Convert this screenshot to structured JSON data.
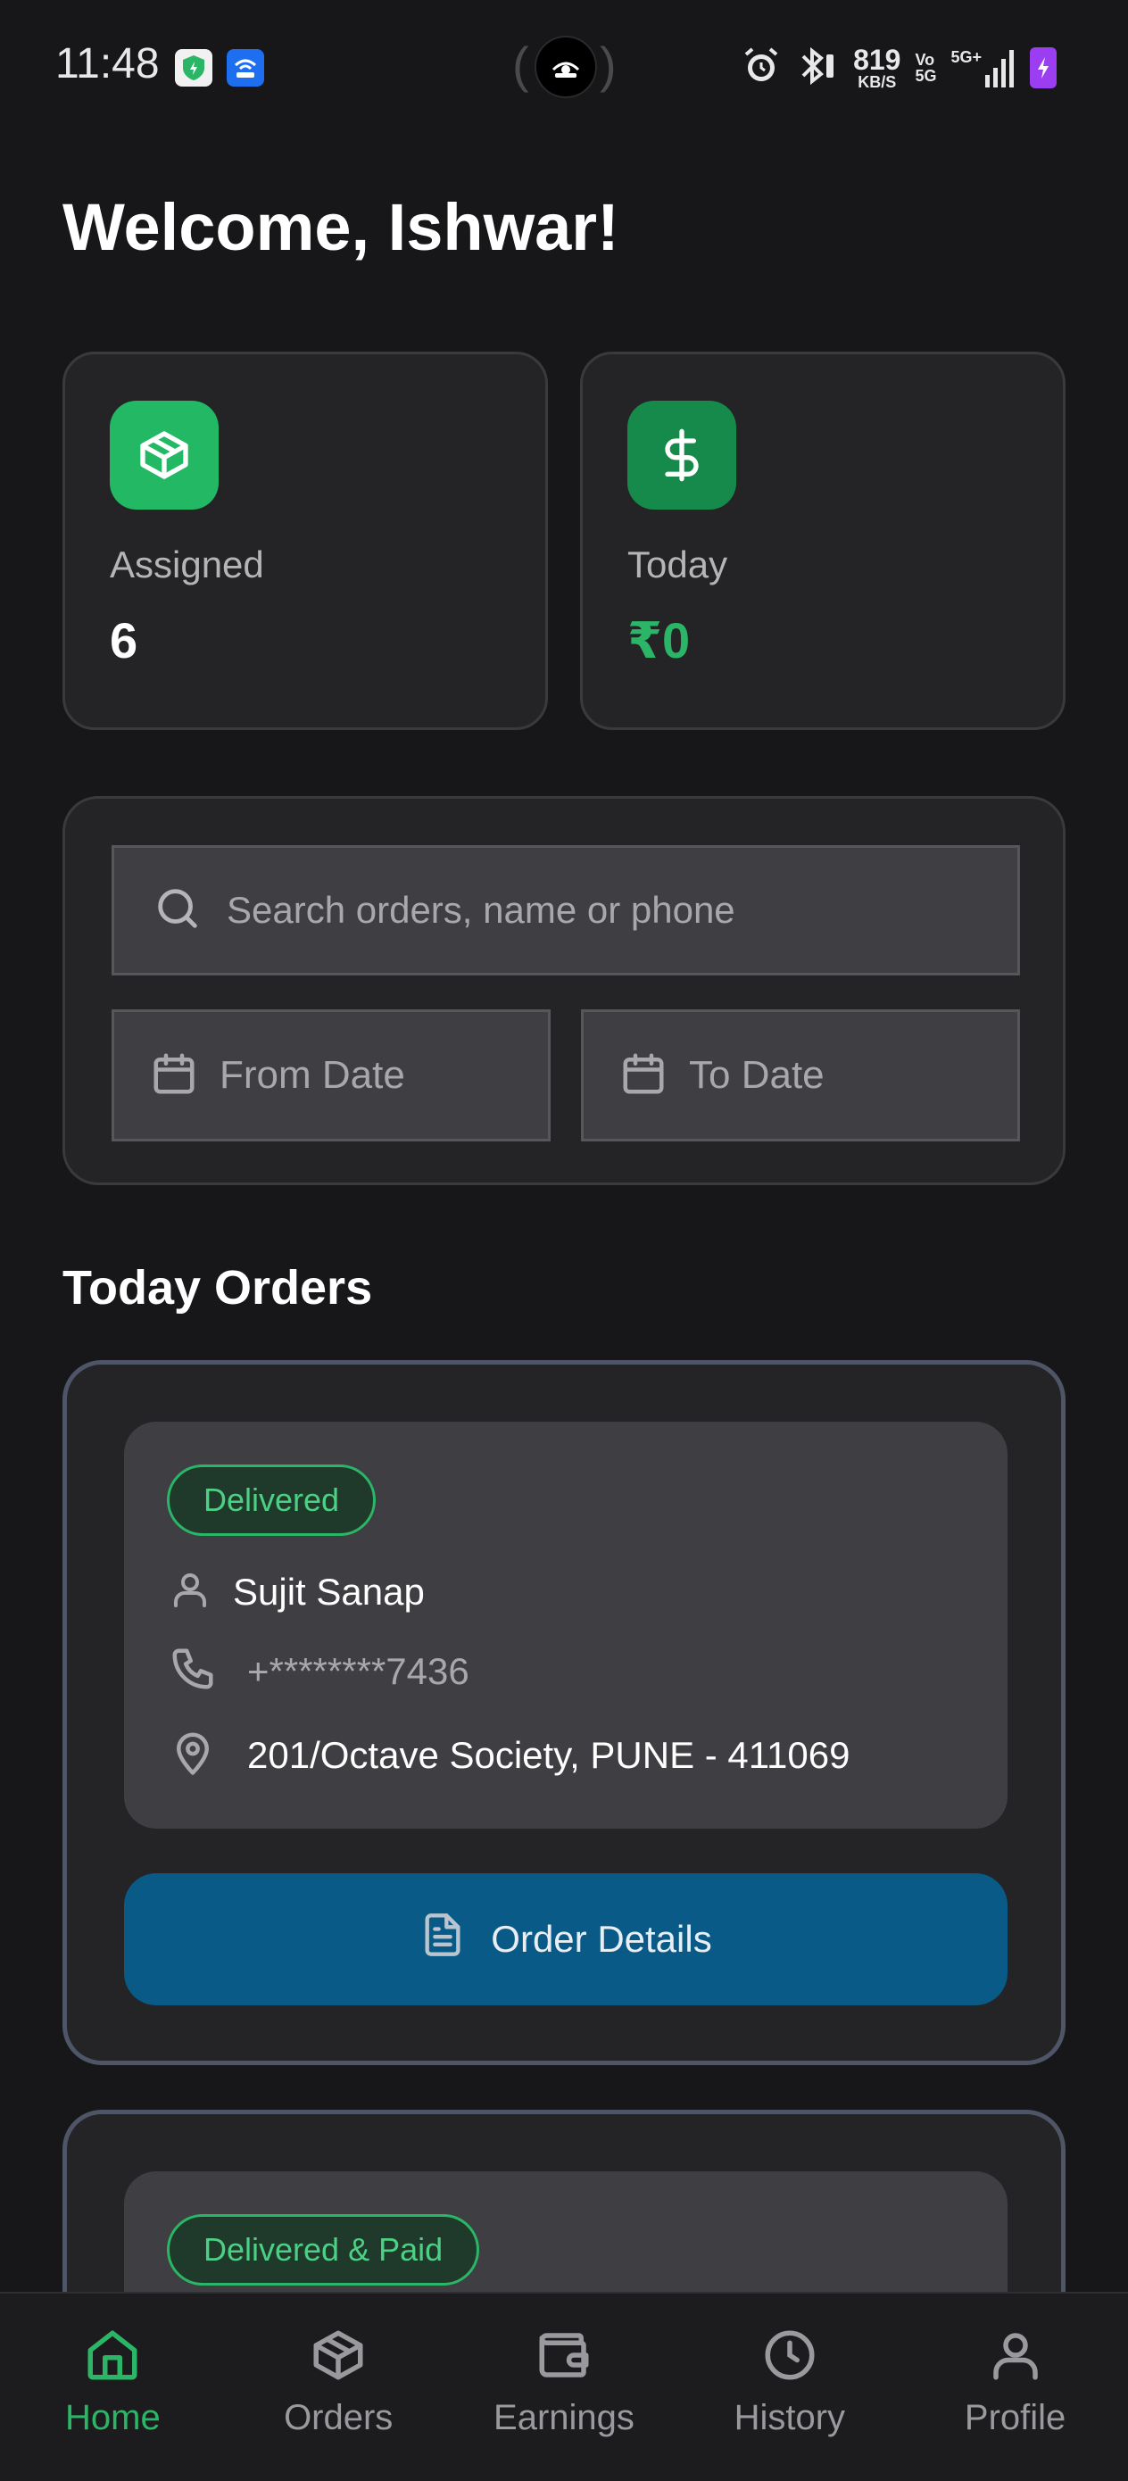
{
  "status_bar": {
    "time": "11:48",
    "net_speed_value": "819",
    "net_speed_unit": "KB/S",
    "volte_top": "Vo",
    "volte_bottom": "5G",
    "signal_label": "5G+"
  },
  "header": {
    "welcome": "Welcome, Ishwar!"
  },
  "stats": {
    "assigned": {
      "label": "Assigned",
      "value": "6",
      "icon": "package-icon"
    },
    "today": {
      "label": "Today",
      "value": "₹0",
      "icon": "dollar-icon"
    }
  },
  "filters": {
    "search_placeholder": "Search orders, name or phone",
    "from_date": "From Date",
    "to_date": "To Date"
  },
  "section": {
    "title": "Today Orders"
  },
  "orders": [
    {
      "status": "Delivered",
      "name": "Sujit Sanap",
      "phone": "+********7436",
      "address": "201/Octave Society, PUNE - 411069",
      "button": "Order Details"
    },
    {
      "status": "Delivered & Paid"
    }
  ],
  "nav": [
    {
      "label": "Home",
      "icon": "home-icon",
      "active": true
    },
    {
      "label": "Orders",
      "icon": "package-icon",
      "active": false
    },
    {
      "label": "Earnings",
      "icon": "wallet-icon",
      "active": false
    },
    {
      "label": "History",
      "icon": "clock-icon",
      "active": false
    },
    {
      "label": "Profile",
      "icon": "user-icon",
      "active": false
    }
  ],
  "colors": {
    "background": "#17171a",
    "card": "#242427",
    "accent_green": "#2bb566",
    "button_blue": "#0a5a88",
    "battery_purple": "#9b3df0"
  }
}
